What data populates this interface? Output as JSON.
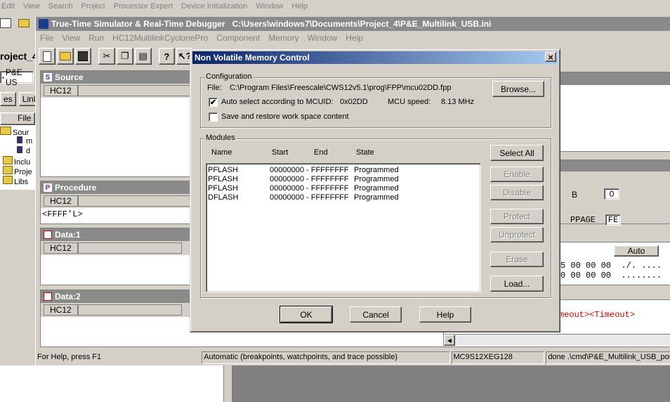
{
  "outer_menu": [
    "Edit",
    "View",
    "Search",
    "Project",
    "Processor Expert",
    "Device Initialization",
    "Window",
    "Help"
  ],
  "project_title": "roject_4",
  "project_combo": "P&E US",
  "project_tabs": [
    "es",
    "Link"
  ],
  "tree_header": "File",
  "tree_items": [
    "Sour",
    "m",
    "d",
    "Inclu",
    "Proje",
    "Libs"
  ],
  "debugger": {
    "title": "True-Time Simulator & Real-Time Debugger   C:\\Users\\windows7\\Documents\\Project_4\\P&E_Multilink_USB.ini",
    "menu": [
      "File",
      "View",
      "Run",
      "HC12MultilinkCyclonePro",
      "Component",
      "Memory",
      "Window",
      "Help"
    ],
    "toolbar_icons": [
      "new-icon",
      "open-icon",
      "save-icon",
      "cut-icon",
      "copy-icon",
      "paste-icon",
      "help-icon",
      "context-help-icon"
    ]
  },
  "panels": {
    "source": {
      "title": "Source",
      "letter": "S",
      "tab": "HC12"
    },
    "procedure": {
      "title": "Procedure",
      "letter": "P",
      "tab": "HC12",
      "content": "<FFFF'L>"
    },
    "data1": {
      "title": "Data:1",
      "tab": "HC12"
    },
    "data2": {
      "title": "Data:2",
      "tab": "HC12"
    }
  },
  "right_panels": {
    "reg_b_label": "B",
    "reg_b_value": "0",
    "ppage_label": "PPAGE",
    "ppage_value": "FE",
    "memory_auto": "Auto",
    "memory_line1": "5 00 00 00  ./. ....",
    "memory_line2": "0 00 00 00  ........",
    "command_text": "meout><Timeout>"
  },
  "status_bar": {
    "help": "For Help, press F1",
    "mode": "Automatic (breakpoints, watchpoints, and trace possible)",
    "mcu": "MC9S12XEG128",
    "cmd": "done .\\cmd\\P&E_Multilink_USB_pos"
  },
  "dialog": {
    "title": "Non Volatile Memory Control",
    "close": "×",
    "config_legend": "Configuration",
    "file_label": "File:",
    "file_path": "C:\\Program Files\\Freescale\\CWS12v5.1\\prog\\FPP\\mcu02DD.fpp",
    "browse": "Browse...",
    "auto_select": "Auto select according to MCUID:",
    "auto_checked": "✔",
    "mcuid": "0x02DD",
    "mcu_speed_label": "MCU speed:",
    "mcu_speed": "8.13 MHz",
    "save_restore": "Save and restore work space content",
    "modules_legend": "Modules",
    "columns": [
      "Name",
      "Start",
      "End",
      "State"
    ],
    "modules": [
      {
        "name": "PFLASH",
        "start": "00000000",
        "end": "- FFFFFFFF",
        "state": "Programmed"
      },
      {
        "name": "PFLASH",
        "start": "00000000",
        "end": "- FFFFFFFF",
        "state": "Programmed"
      },
      {
        "name": "PFLASH",
        "start": "00000000",
        "end": "- FFFFFFFF",
        "state": "Programmed"
      },
      {
        "name": "DFLASH",
        "start": "00000000",
        "end": "- FFFFFFFF",
        "state": "Programmed"
      }
    ],
    "buttons": {
      "select_all": "Select All",
      "enable": "Enable",
      "disable": "Disable",
      "protect": "Protect",
      "unprotect": "Unprotect",
      "erase": "Erase",
      "load": "Load...",
      "ok": "OK",
      "cancel": "Cancel",
      "help": "Help"
    }
  },
  "colors": {
    "dialog_title_start": "#0a246a",
    "dialog_title_end": "#a6caf0",
    "inactive_title": "#8a8a8a",
    "red_text": "#cc0000"
  }
}
